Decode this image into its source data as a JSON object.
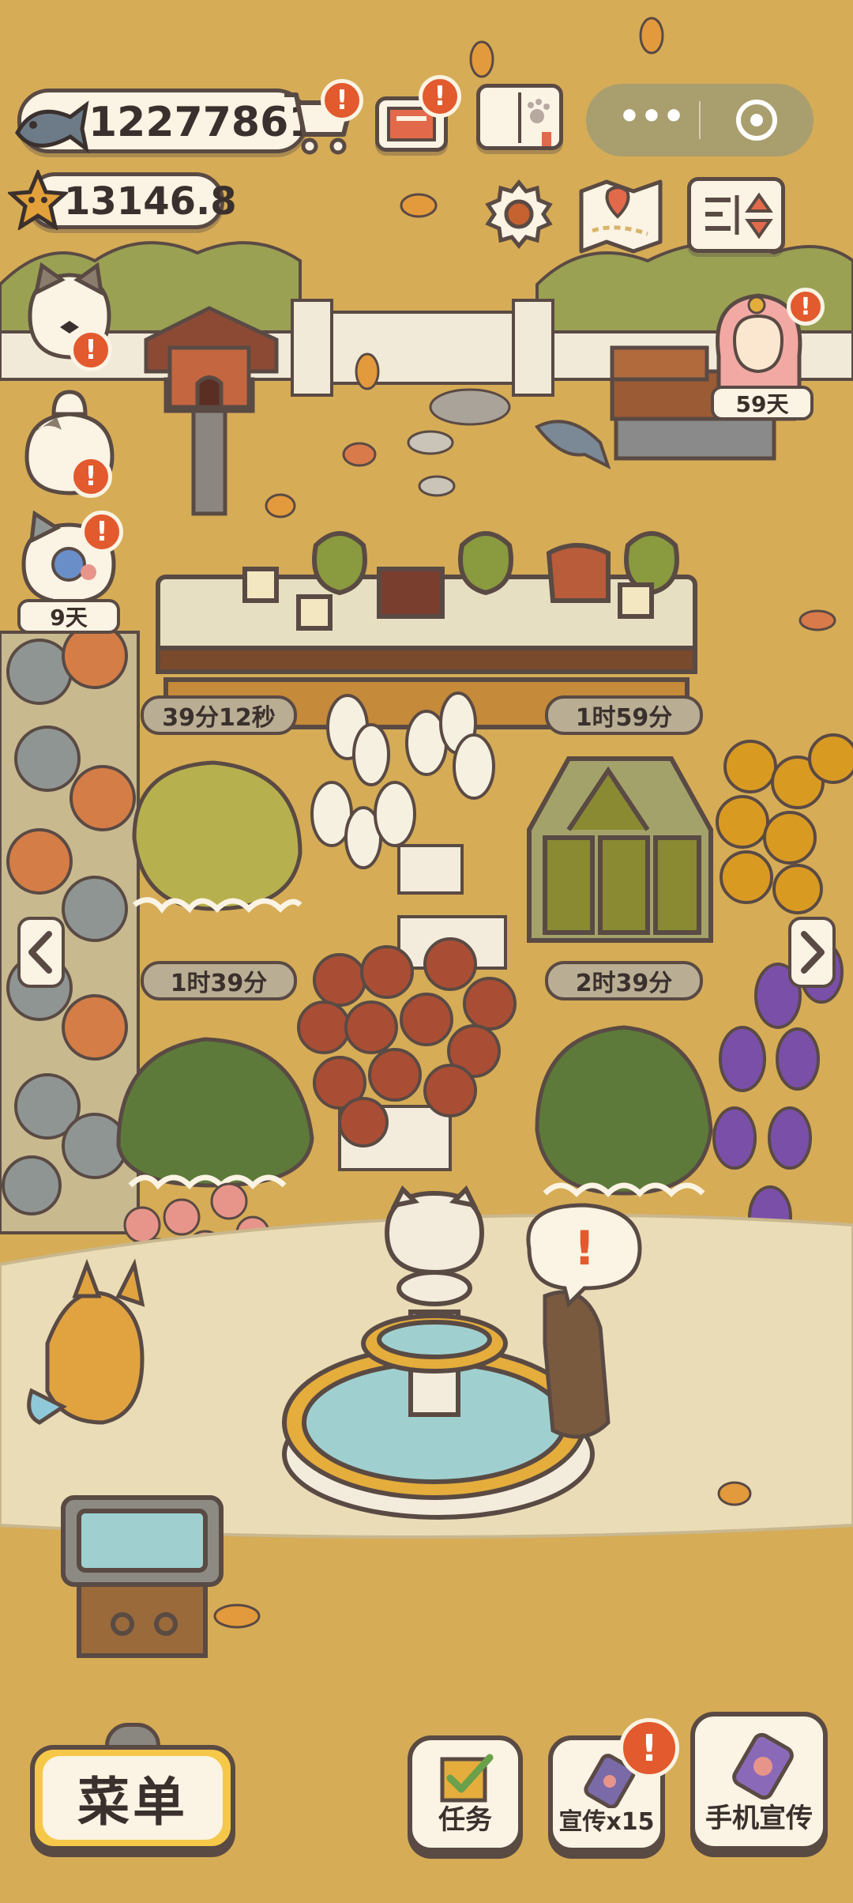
{
  "currencies": {
    "fish_count": "12277861",
    "star_count": "13146.8"
  },
  "mini_program": {
    "more_glyph": "•••"
  },
  "characters": {
    "merchant_days": "59天",
    "cat_days": "9天"
  },
  "timers": {
    "counter_left": "39分12秒",
    "counter_right": "1时59分",
    "plot_left": "1时39分",
    "plot_right": "2时39分"
  },
  "alerts": {
    "exclamation": "!"
  },
  "bottom_bar": {
    "menu_label": "菜单",
    "tasks_label": "任务",
    "promote_label": "宣传x15",
    "phone_promote_label": "手机宣传"
  },
  "colors": {
    "ground": "#d6ac56",
    "path": "#eadcb6",
    "panel": "#fbf3e3",
    "outline": "#5a4a44",
    "badge": "#e25a2d",
    "menu_accent": "#f6c84a",
    "water": "#9fd0cf",
    "bush_dark": "#5d7a3a",
    "bush_light": "#b7b04e",
    "lavender": "#7a4fa8"
  }
}
